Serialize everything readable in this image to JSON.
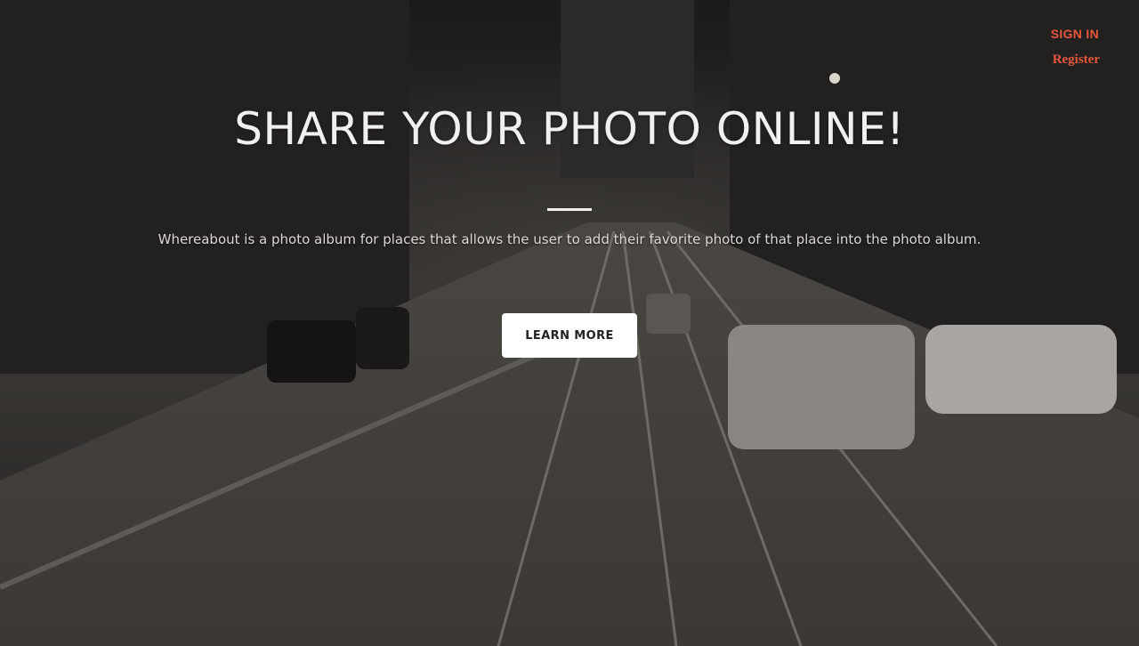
{
  "nav": {
    "sign_in_label": "SIGN IN",
    "register_label": "Register"
  },
  "hero": {
    "headline": "SHARE YOUR PHOTO ONLINE!",
    "tagline": "Whereabout is a photo album for places that allows the user to add their favorite photo of that place into the photo album.",
    "cta_label": "LEARN MORE"
  },
  "colors": {
    "accent": "#e8563c",
    "headline_text": "#f2f0ee",
    "button_bg": "#ffffff",
    "button_text": "#222222"
  }
}
